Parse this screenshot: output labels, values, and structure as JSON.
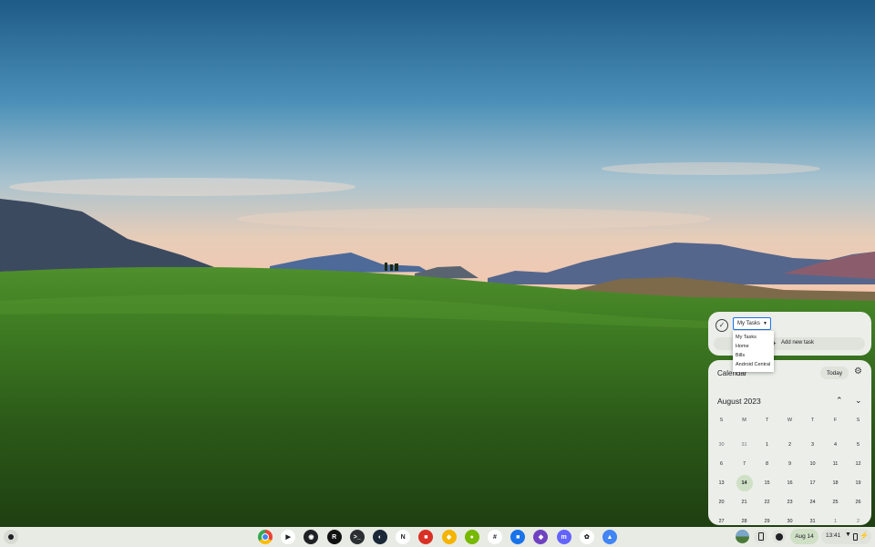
{
  "tasks": {
    "selected_list": "My Tasks",
    "add_task_label": "Add new task",
    "list_options": [
      "My Tasks",
      "Home",
      "Bills",
      "Android Central"
    ]
  },
  "calendar": {
    "title": "Calendar",
    "today_label": "Today",
    "month_label": "August 2023",
    "weekdays": [
      "S",
      "M",
      "T",
      "W",
      "T",
      "F",
      "S"
    ],
    "weeks": [
      [
        "30",
        "31",
        "1",
        "2",
        "3",
        "4",
        "5"
      ],
      [
        "6",
        "7",
        "8",
        "9",
        "10",
        "11",
        "12"
      ],
      [
        "13",
        "14",
        "15",
        "16",
        "17",
        "18",
        "19"
      ],
      [
        "20",
        "21",
        "22",
        "23",
        "24",
        "25",
        "26"
      ],
      [
        "27",
        "28",
        "29",
        "30",
        "31",
        "1",
        "2"
      ]
    ],
    "today": "14"
  },
  "shelf": {
    "apps": [
      {
        "name": "chrome",
        "color": "#e8453c",
        "glyph": ""
      },
      {
        "name": "play-store",
        "color": "#ffffff",
        "glyph": "▶"
      },
      {
        "name": "app-3",
        "color": "#202124",
        "glyph": "◉"
      },
      {
        "name": "app-r",
        "color": "#111111",
        "glyph": "R"
      },
      {
        "name": "terminal",
        "color": "#2b2f33",
        "glyph": ">_"
      },
      {
        "name": "steam",
        "color": "#1b2838",
        "glyph": "◐"
      },
      {
        "name": "notion",
        "color": "#ffffff",
        "glyph": "N"
      },
      {
        "name": "app-red",
        "color": "#d93025",
        "glyph": "■"
      },
      {
        "name": "app-colorful",
        "color": "#f4b400",
        "glyph": "◆"
      },
      {
        "name": "nvidia",
        "color": "#76b900",
        "glyph": "●"
      },
      {
        "name": "slack",
        "color": "#ffffff",
        "glyph": "#"
      },
      {
        "name": "app-blue",
        "color": "#1a73e8",
        "glyph": "■"
      },
      {
        "name": "app-purple",
        "color": "#6f42c1",
        "glyph": "◆"
      },
      {
        "name": "mastodon",
        "color": "#6364ff",
        "glyph": "m"
      },
      {
        "name": "photos",
        "color": "#ffffff",
        "glyph": "✿"
      },
      {
        "name": "app-flask",
        "color": "#4285f4",
        "glyph": "▲"
      }
    ],
    "date": "Aug 14",
    "time": "13:41"
  }
}
